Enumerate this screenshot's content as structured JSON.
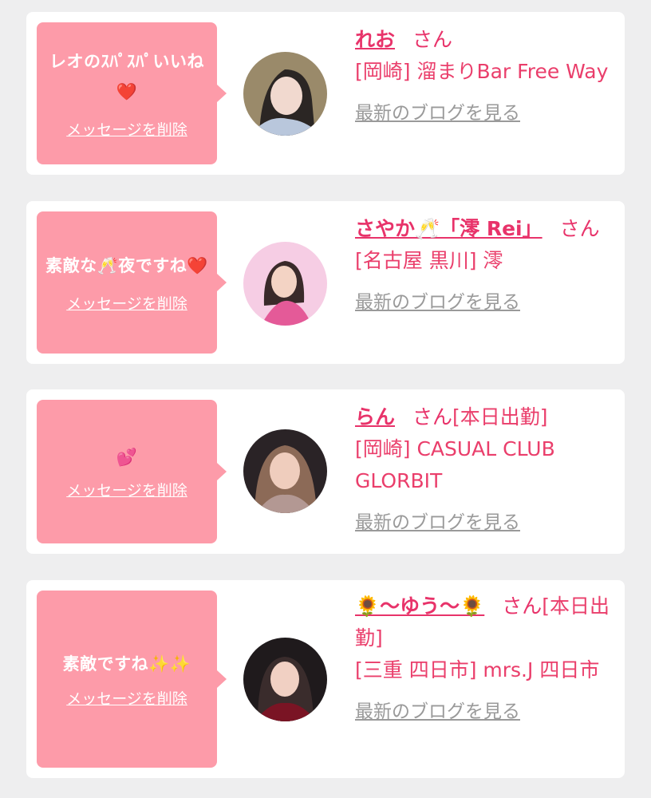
{
  "common": {
    "san_label": "さん",
    "delete_label": "メッセージを削除",
    "blog_label": "最新のブログを見る"
  },
  "cards": [
    {
      "message": "レオのｽﾊﾟｽﾊﾟいいね❤️",
      "name": "れお",
      "status": "",
      "shop": "[岡崎] 溜まりBar Free Way",
      "avatar_palette": [
        "#9a8a6a",
        "#2b2624",
        "#f1d9cf",
        "#b9c7dc"
      ]
    },
    {
      "message": "素敵な🥂夜ですね❤️",
      "name": "さやか🥂「澪 Rei」",
      "status": "",
      "shop": "[名古屋 黒川] 澪",
      "avatar_palette": [
        "#f6cde4",
        "#3a2a2a",
        "#f3d3c4",
        "#e45a98"
      ]
    },
    {
      "message": "💕",
      "name": "らん",
      "status": "[本日出勤]",
      "shop": "[岡崎] CASUAL CLUB GLORBIT",
      "avatar_palette": [
        "#2a2326",
        "#8c6a57",
        "#efcdbd",
        "#b39893"
      ]
    },
    {
      "message": "素敵ですね✨✨",
      "name": "🌻〜ゆう〜🌻",
      "status": "[本日出勤]",
      "shop": "[三重 四日市] mrs.J 四日市",
      "avatar_palette": [
        "#1f1a1c",
        "#3a2c2c",
        "#f1d0c3",
        "#7a1424"
      ]
    }
  ]
}
